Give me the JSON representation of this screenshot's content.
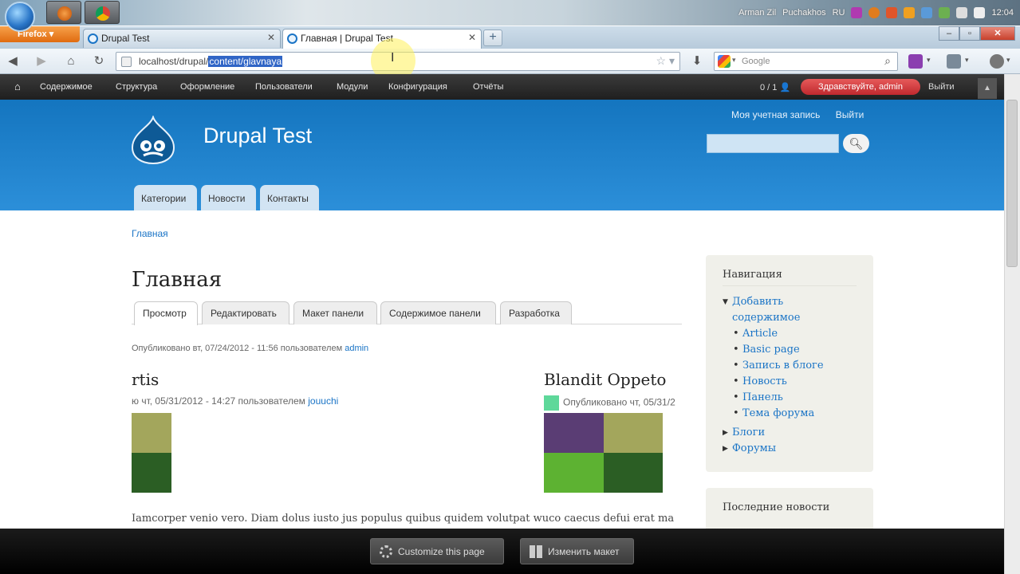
{
  "os": {
    "tray": {
      "user1": "Arman Zil",
      "user2": "Puchakhos",
      "lang": "RU",
      "clock": "12:04"
    }
  },
  "browser": {
    "firefox_label": "Firefox",
    "tabs": [
      {
        "label": "Drupal Test"
      },
      {
        "label": "Главная | Drupal Test"
      }
    ],
    "new_tab_symbol": "+",
    "url": {
      "prefix": "localhost/drupal/",
      "selected": "content/glavnaya"
    },
    "search_placeholder": "Google"
  },
  "toolbar": {
    "menu": [
      "Содержимое",
      "Структура",
      "Оформление",
      "Пользователи",
      "Модули",
      "Конфигурация",
      "Отчёты"
    ],
    "count": "0 / 1",
    "hello": "Здравствуйте, admin",
    "logout": "Выйти"
  },
  "header": {
    "site_name": "Drupal Test",
    "secondary_links": [
      "Моя учетная запись",
      "Выйти"
    ],
    "main_menu": [
      "Категории",
      "Новости",
      "Контакты"
    ]
  },
  "content": {
    "breadcrumb": "Главная",
    "title": "Главная",
    "tabs": [
      "Просмотр",
      "Редактировать",
      "Макет панели",
      "Содержимое панели",
      "Разработка"
    ],
    "published": {
      "text": "Опубликовано вт, 07/24/2012 - 11:56 пользователем",
      "author": "admin"
    },
    "pane_left": {
      "title": "rtis",
      "meta": "ю чт, 05/31/2012 - 14:27 пользователем",
      "author": "jouuchi"
    },
    "pane_right": {
      "title": "Blandit Oppeto",
      "meta": "Опубликовано чт, 05/31/2"
    },
    "body_text": "Iamcorper venio vero. Diam dolus iusto jus populus quibus quidem volutpat wuco caecus defui erat ma"
  },
  "sidebar": {
    "nav_title": "Навигация",
    "nav_items": [
      {
        "label": "Добавить",
        "level": 0
      },
      {
        "label": "содержимое",
        "level": 0
      },
      {
        "label": "Article",
        "level": 1
      },
      {
        "label": "Basic page",
        "level": 1
      },
      {
        "label": "Запись в блоге",
        "level": 1
      },
      {
        "label": "Новость",
        "level": 1
      },
      {
        "label": "Панель",
        "level": 1
      },
      {
        "label": "Тема форума",
        "level": 1
      },
      {
        "label": "Блоги",
        "level": 0
      },
      {
        "label": "Форумы",
        "level": 0
      }
    ],
    "news_title": "Последние новости"
  },
  "bottom": {
    "customize": "Customize this page",
    "change_layout": "Изменить макет"
  },
  "colors": {
    "header_blue": "#1475bf",
    "link_blue": "#1a74c6",
    "toolbar_dark": "#2a2a2a",
    "hello_red": "#d03a3a"
  }
}
